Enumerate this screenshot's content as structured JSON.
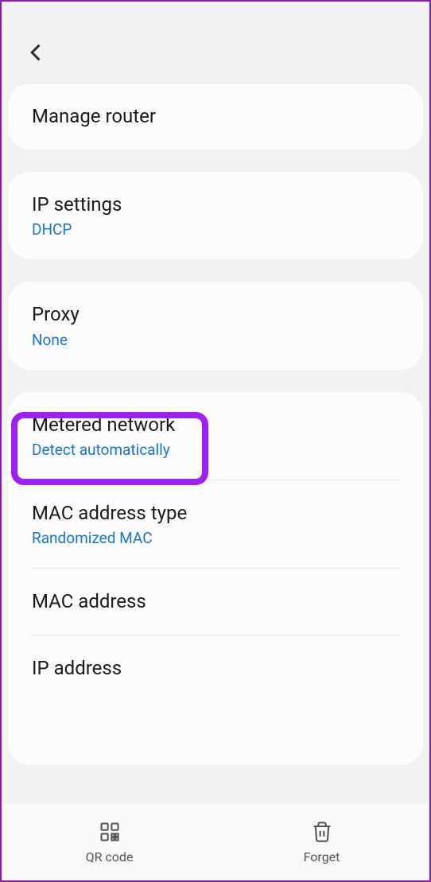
{
  "items": {
    "manage_router": {
      "title": "Manage router"
    },
    "ip_settings": {
      "title": "IP settings",
      "value": "DHCP"
    },
    "proxy": {
      "title": "Proxy",
      "value": "None"
    },
    "metered_network": {
      "title": "Metered network",
      "value": "Detect automatically"
    },
    "mac_address_type": {
      "title": "MAC address type",
      "value": "Randomized MAC"
    },
    "mac_address": {
      "title": "MAC address"
    },
    "ip_address": {
      "title": "IP address"
    }
  },
  "bottom": {
    "qr_code": "QR code",
    "forget": "Forget"
  }
}
